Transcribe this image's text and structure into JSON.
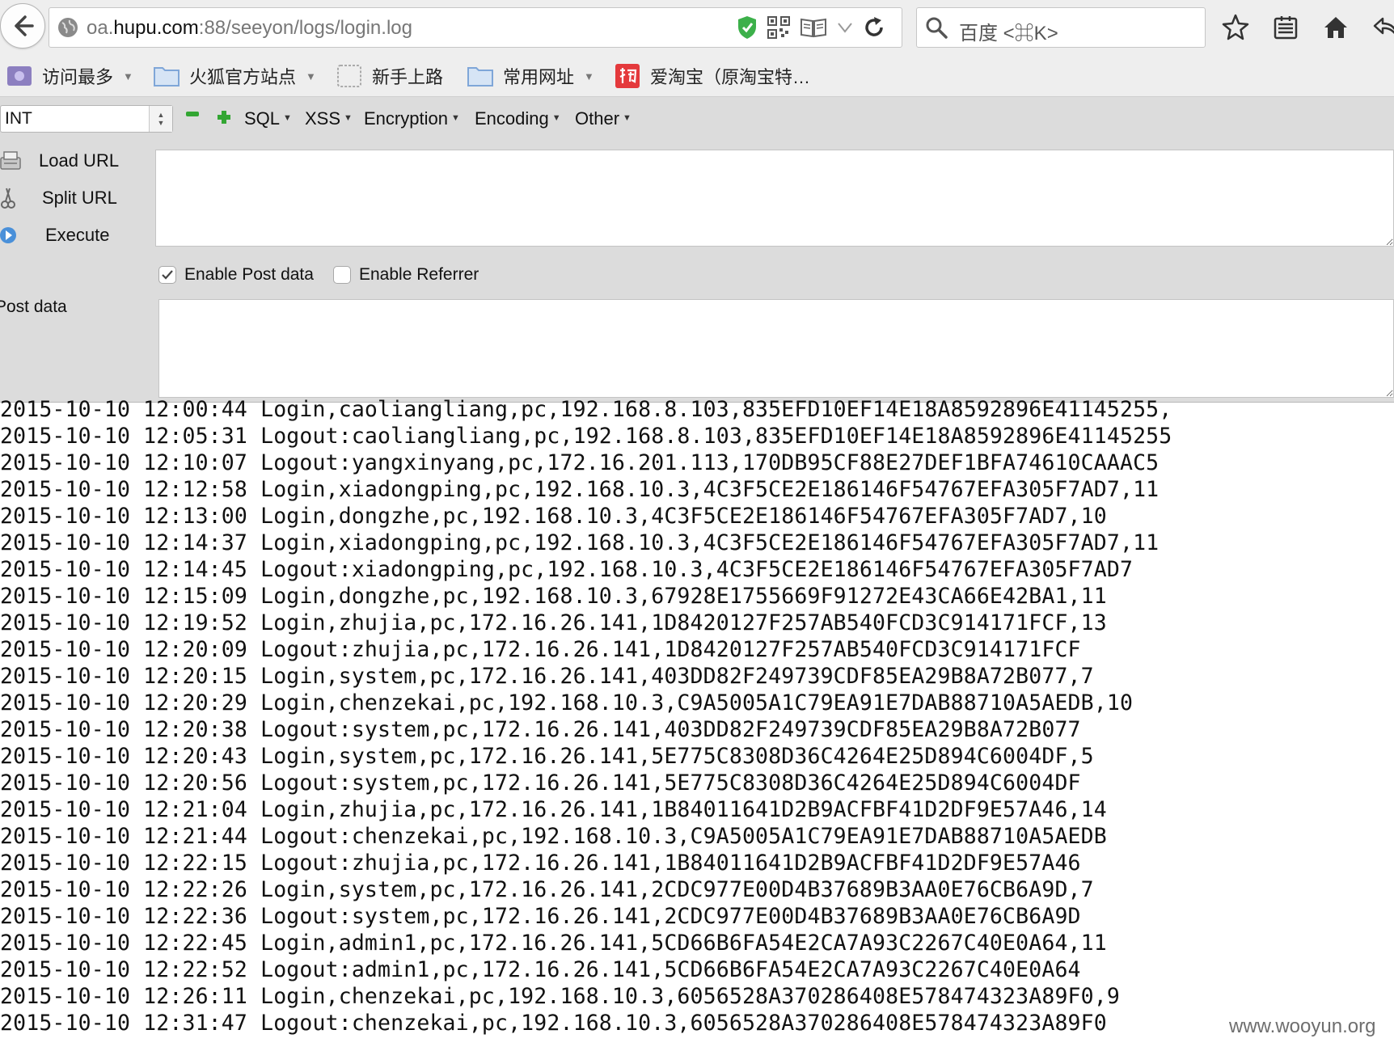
{
  "navbar": {
    "url_host": "oa.",
    "url_domain": "hupu.com",
    "url_path": ":88/seeyon/logs/login.log",
    "search_placeholder": "百度 <⌘K>"
  },
  "bookmarks": [
    {
      "label": "访问最多",
      "has_menu": true
    },
    {
      "label": "火狐官方站点",
      "has_menu": true
    },
    {
      "label": "新手上路",
      "has_menu": false
    },
    {
      "label": "常用网址",
      "has_menu": true
    },
    {
      "label": "爱淘宝（原淘宝特…",
      "has_menu": false
    }
  ],
  "hackbar": {
    "type_value": "INT",
    "menus": [
      "SQL",
      "XSS",
      "Encryption",
      "Encoding",
      "Other"
    ],
    "actions": [
      "Load URL",
      "Split URL",
      "Execute"
    ],
    "enable_post_label": "Enable Post data",
    "enable_post_checked": true,
    "enable_referrer_label": "Enable Referrer",
    "enable_referrer_checked": false,
    "post_data_label": "Post data",
    "url_value": "",
    "post_value": ""
  },
  "log_lines": [
    "2015-10-10 12:00:44 Login,caoliangliang,pc,192.168.8.103,835EFD10EF14E18A8592896E41145255,",
    "2015-10-10 12:05:31 Logout:caoliangliang,pc,192.168.8.103,835EFD10EF14E18A8592896E41145255",
    "2015-10-10 12:10:07 Logout:yangxinyang,pc,172.16.201.113,170DB95CF88E27DEF1BFA74610CAAAC5",
    "2015-10-10 12:12:58 Login,xiadongping,pc,192.168.10.3,4C3F5CE2E186146F54767EFA305F7AD7,11",
    "2015-10-10 12:13:00 Login,dongzhe,pc,192.168.10.3,4C3F5CE2E186146F54767EFA305F7AD7,10",
    "2015-10-10 12:14:37 Login,xiadongping,pc,192.168.10.3,4C3F5CE2E186146F54767EFA305F7AD7,11",
    "2015-10-10 12:14:45 Logout:xiadongping,pc,192.168.10.3,4C3F5CE2E186146F54767EFA305F7AD7",
    "2015-10-10 12:15:09 Login,dongzhe,pc,192.168.10.3,67928E1755669F91272E43CA66E42BA1,11",
    "2015-10-10 12:19:52 Login,zhujia,pc,172.16.26.141,1D8420127F257AB540FCD3C914171FCF,13",
    "2015-10-10 12:20:09 Logout:zhujia,pc,172.16.26.141,1D8420127F257AB540FCD3C914171FCF",
    "2015-10-10 12:20:15 Login,system,pc,172.16.26.141,403DD82F249739CDF85EA29B8A72B077,7",
    "2015-10-10 12:20:29 Login,chenzekai,pc,192.168.10.3,C9A5005A1C79EA91E7DAB88710A5AEDB,10",
    "2015-10-10 12:20:38 Logout:system,pc,172.16.26.141,403DD82F249739CDF85EA29B8A72B077",
    "2015-10-10 12:20:43 Login,system,pc,172.16.26.141,5E775C8308D36C4264E25D894C6004DF,5",
    "2015-10-10 12:20:56 Logout:system,pc,172.16.26.141,5E775C8308D36C4264E25D894C6004DF",
    "2015-10-10 12:21:04 Login,zhujia,pc,172.16.26.141,1B84011641D2B9ACFBF41D2DF9E57A46,14",
    "2015-10-10 12:21:44 Logout:chenzekai,pc,192.168.10.3,C9A5005A1C79EA91E7DAB88710A5AEDB",
    "2015-10-10 12:22:15 Logout:zhujia,pc,172.16.26.141,1B84011641D2B9ACFBF41D2DF9E57A46",
    "2015-10-10 12:22:26 Login,system,pc,172.16.26.141,2CDC977E00D4B37689B3AA0E76CB6A9D,7",
    "2015-10-10 12:22:36 Logout:system,pc,172.16.26.141,2CDC977E00D4B37689B3AA0E76CB6A9D",
    "2015-10-10 12:22:45 Login,admin1,pc,172.16.26.141,5CD66B6FA54E2CA7A93C2267C40E0A64,11",
    "2015-10-10 12:22:52 Logout:admin1,pc,172.16.26.141,5CD66B6FA54E2CA7A93C2267C40E0A64",
    "2015-10-10 12:26:11 Login,chenzekai,pc,192.168.10.3,6056528A370286408E578474323A89F0,9",
    "2015-10-10 12:31:47 Logout:chenzekai,pc,192.168.10.3,6056528A370286408E578474323A89F0"
  ],
  "watermark": "www.wooyun.org",
  "colors": {
    "chrome_bg": "#eeeeee",
    "hackbar_bg": "#dcdcdc",
    "shield_green": "#3cb04a",
    "plus_green": "#33a633",
    "taobao_red": "#e4393c",
    "folder_blue": "#7fa6d8"
  },
  "icons": [
    "back-arrow-icon",
    "globe-icon",
    "shield-icon",
    "qr-code-icon",
    "reader-icon",
    "dropdown-icon",
    "reload-icon",
    "search-icon",
    "star-icon",
    "clipboard-icon",
    "home-icon",
    "share-icon"
  ]
}
